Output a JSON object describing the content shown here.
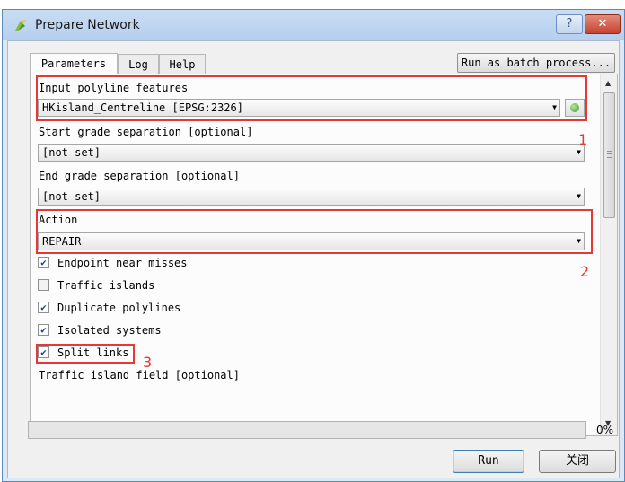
{
  "window": {
    "title": "Prepare Network",
    "help_glyph": "?",
    "close_glyph": "✕"
  },
  "tabs": [
    {
      "label": "Parameters"
    },
    {
      "label": "Log"
    },
    {
      "label": "Help"
    }
  ],
  "batch_button": "Run as batch process...",
  "params": {
    "input_label": "Input polyline features",
    "input_value": "HKisland_Centreline [EPSG:2326]",
    "start_label": "Start grade separation [optional]",
    "start_value": "[not set]",
    "end_label": "End grade separation [optional]",
    "end_value": "[not set]",
    "action_label": "Action",
    "action_value": "REPAIR",
    "checkboxes": [
      {
        "label": "Endpoint near misses",
        "checked": true
      },
      {
        "label": "Traffic islands",
        "checked": false
      },
      {
        "label": "Duplicate polylines",
        "checked": true
      },
      {
        "label": "Isolated systems",
        "checked": true
      },
      {
        "label": "Split links",
        "checked": true
      }
    ],
    "traffic_island_label": "Traffic island field [optional]"
  },
  "annotations": [
    "1",
    "2",
    "3"
  ],
  "progress": {
    "value": 0,
    "text": "0%"
  },
  "buttons": {
    "run": "Run",
    "close": "关闭"
  },
  "colors": {
    "annotation": "#e53935",
    "check": "#1f3f8f",
    "close_button": "#c5432e"
  }
}
